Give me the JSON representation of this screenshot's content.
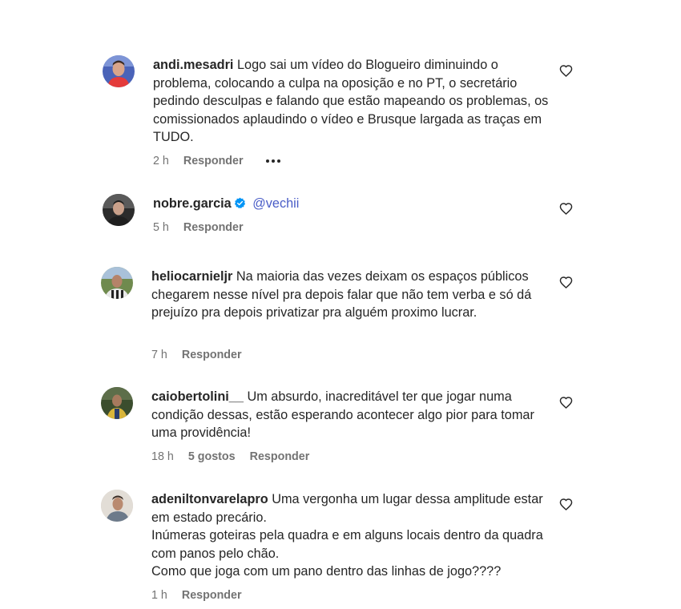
{
  "comments": [
    {
      "username": "andi.mesadri",
      "text": "Logo sai um vídeo do Blogueiro diminuindo o problema, colocando a culpa na oposição e no PT, o secretário pedindo desculpas e falando que estão mapeando os problemas, os comissionados aplaudindo o vídeo e Brusque largada as traças em TUDO.",
      "time": "2 h",
      "reply": "Responder",
      "avatar_icon": "profile-photo"
    },
    {
      "username": "nobre.garcia",
      "mention": "@vechii",
      "verified": true,
      "time": "5 h",
      "reply": "Responder",
      "avatar_icon": "profile-photo"
    },
    {
      "username": "heliocarnieljr",
      "text": "Na maioria das vezes deixam os espaços públicos chegarem nesse nível pra depois falar que não tem verba e só dá prejuízo pra depois privatizar pra alguém proximo lucrar.",
      "time": "7 h",
      "reply": "Responder",
      "avatar_icon": "profile-photo"
    },
    {
      "username": "caiobertolini__",
      "text": "Um absurdo, inacreditável ter que jogar numa condição dessas, estão esperando acontecer algo pior para tomar uma providência!",
      "time": "18 h",
      "likes": "5 gostos",
      "reply": "Responder",
      "avatar_icon": "profile-photo"
    },
    {
      "username": "adeniltonvarelapro",
      "text": "Uma vergonha um lugar dessa amplitude estar em estado precário.",
      "text_line2": "Inúmeras goteiras pela quadra e em alguns locais dentro da quadra com panos pelo chão.",
      "text_line3": "Como que joga com um pano dentro das linhas de jogo????",
      "time": "1 h",
      "reply": "Responder",
      "avatar_icon": "profile-photo"
    }
  ],
  "colors": {
    "text": "#262626",
    "meta": "#737373",
    "mention": "#4a5dc7",
    "verified": "#0095f6"
  },
  "icons": {
    "like": "heart-outline-icon",
    "more": "more-options-icon",
    "verified": "verified-badge-icon"
  }
}
